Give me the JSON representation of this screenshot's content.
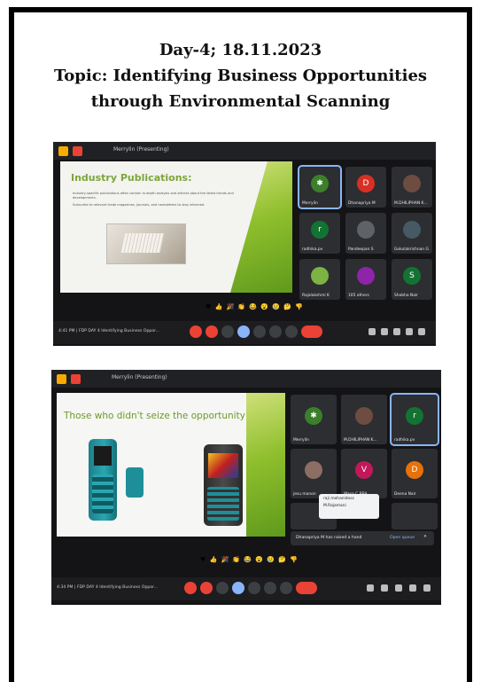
{
  "heading": {
    "line1": "Day-4; 18.11.2023",
    "line2": "Topic: Identifying Business Opportunities",
    "line3": "through Environmental Scanning"
  },
  "screenshot1": {
    "presenter_label": "Merrylin (Presenting)",
    "slide": {
      "title": "Industry Publications:",
      "bullet1": "Industry-specific publications often contain in-depth analysis and articles about the latest trends and developments.",
      "bullet2": "Subscribe to relevant trade magazines, journals, and newsletters to stay informed."
    },
    "participants": [
      {
        "name": "Merrylin",
        "initial": "",
        "color": "#3b7f2b"
      },
      {
        "name": "Dhanapriya M",
        "initial": "D",
        "color": "#d93025"
      },
      {
        "name": "M.DHILIPHAN K...",
        "initial": "",
        "color": "#6d4c41"
      },
      {
        "name": "radhika.pv",
        "initial": "r",
        "color": "#137333"
      },
      {
        "name": "Pandeepan S",
        "initial": "",
        "color": "#5f6368"
      },
      {
        "name": "Gokulakrishnan G",
        "initial": "",
        "color": "#455a64"
      },
      {
        "name": "Rajalakshmi K",
        "initial": "",
        "color": "#7cb342"
      },
      {
        "name": "105 others",
        "initial": "",
        "color": "#8e24aa"
      },
      {
        "name": "Shobha Nair",
        "initial": "S",
        "color": "#137333"
      }
    ],
    "time_meeting": "4:41 PM | FDP DAY 4 Identifying Business Oppor..."
  },
  "screenshot2": {
    "presenter_label": "Merrylin (Presenting)",
    "slide": {
      "title": "Those who didn't seize the opportunity"
    },
    "participants": [
      {
        "name": "Merrylin",
        "initial": "",
        "color": "#3b7f2b"
      },
      {
        "name": "M.DHILIPHAN K...",
        "initial": "",
        "color": "#6d4c41"
      },
      {
        "name": "radhika.pv",
        "initial": "r",
        "color": "#137333"
      },
      {
        "name": "jesu manon",
        "initial": "",
        "color": "#8d6e63"
      },
      {
        "name": "Wasa C BBA",
        "initial": "V",
        "color": "#c2185b"
      },
      {
        "name": "Deena Nair",
        "initial": "D",
        "color": "#e8710a"
      }
    ],
    "popup": {
      "line1": "raji mohanidoss",
      "line2": "M.Rajamani"
    },
    "raised_hand": {
      "text": "Dhanapriya M has raised a hand",
      "action": "Open queue",
      "close": "✕"
    },
    "time_meeting": "4:34 PM | FDP DAY 4 Identifying Business Oppor..."
  },
  "reactions": "♥ 👍 🎉 👏 😂 😮 😢 🤔 👎"
}
